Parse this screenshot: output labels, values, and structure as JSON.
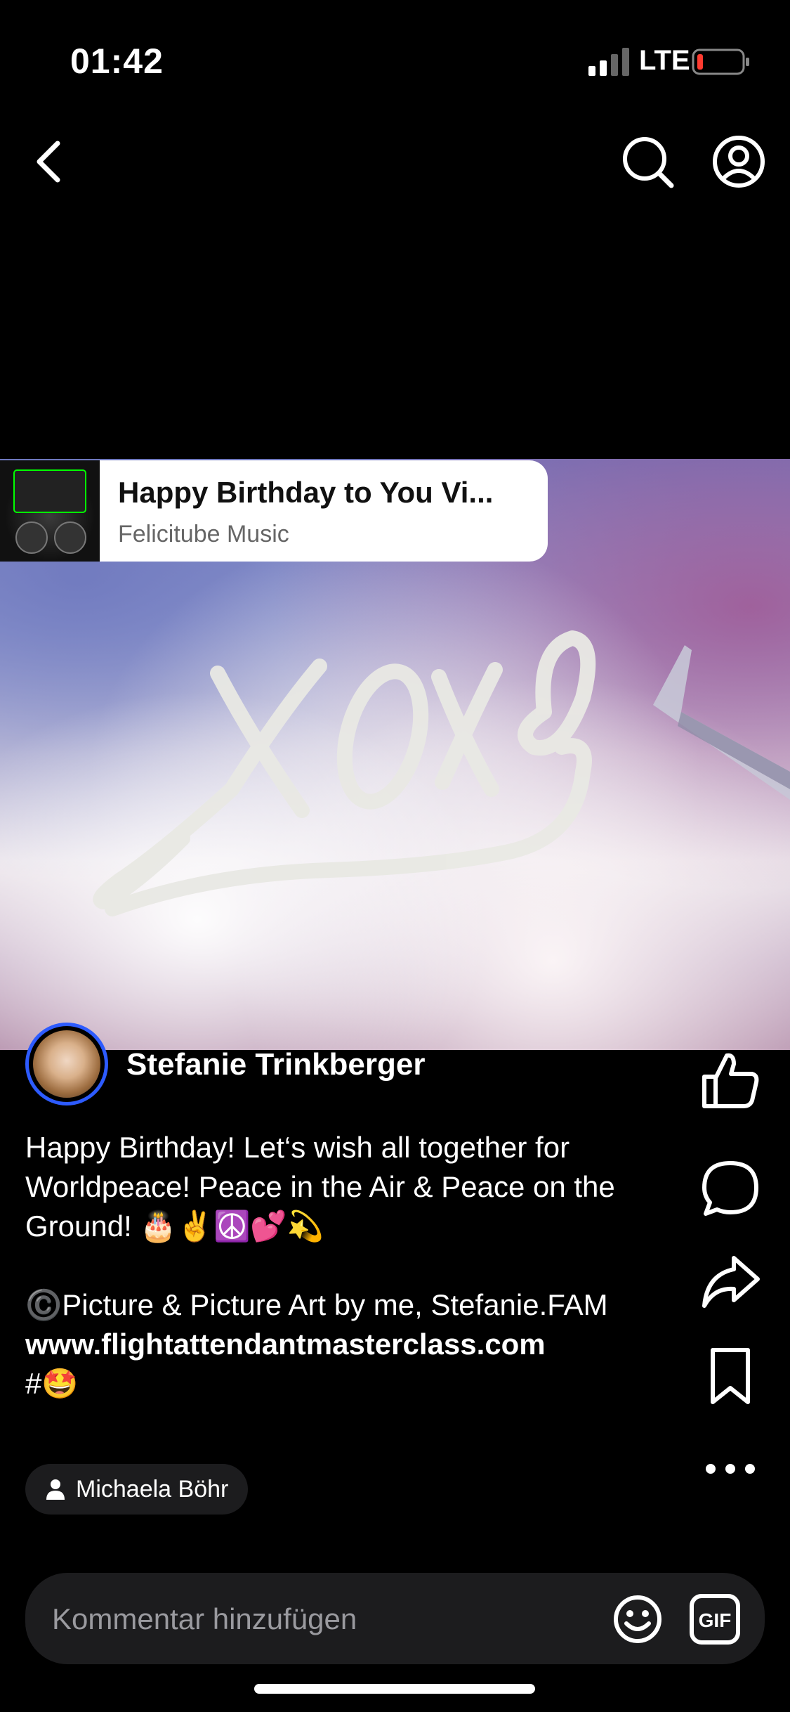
{
  "status_bar": {
    "time": "01:42",
    "network": "LTE"
  },
  "nav": {
    "back_icon": "chevron-left-icon",
    "search_icon": "search-icon",
    "profile_icon": "profile-icon"
  },
  "music": {
    "title": "Happy Birthday to You Vi...",
    "artist": "Felicitube Music"
  },
  "media": {
    "overlay_text": "xoxo"
  },
  "post": {
    "author": "Stefanie Trinkberger",
    "caption_lines": [
      "Happy Birthday! Let‘s wish all together for",
      "Worldpeace! Peace in the Air & Peace on the",
      "Ground! 🎂✌️☮️💕💫"
    ],
    "credit": "©️Picture & Picture Art by me, Stefanie.FAM",
    "url": "www.flightattendantmasterclass.com",
    "hashtag": "#🤩",
    "tagged_user": "Michaela Böhr"
  },
  "comment_bar": {
    "placeholder": "Kommentar hinzufügen",
    "gif_label": "GIF"
  },
  "colors": {
    "background": "#000000",
    "avatar_ring": "#2d5bff",
    "battery_low": "#ff3b30"
  }
}
